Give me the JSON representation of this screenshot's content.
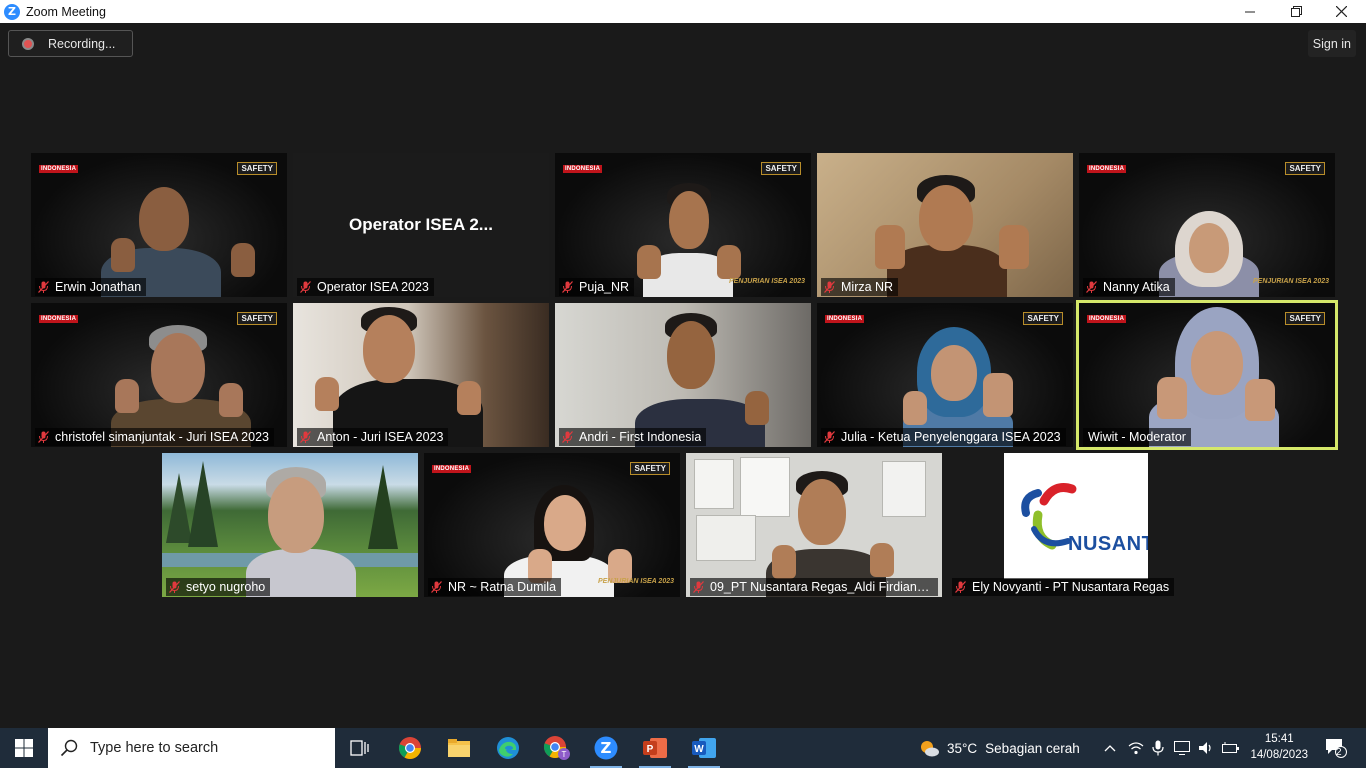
{
  "window": {
    "title": "Zoom Meeting",
    "minimize_icon": "minimize-icon",
    "maximize_icon": "restore-icon",
    "close_icon": "close-icon"
  },
  "toolbar": {
    "recording_label": "Recording...",
    "signin_label": "Sign in"
  },
  "participants": [
    {
      "name": "Erwin Jonathan",
      "muted": true
    },
    {
      "name": "Operator ISEA 2023",
      "muted": true,
      "center_label": "Operator ISEA 2..."
    },
    {
      "name": "Puja_NR",
      "muted": true
    },
    {
      "name": "Mirza NR",
      "muted": true
    },
    {
      "name": "Nanny Atika",
      "muted": true
    },
    {
      "name": "christofel simanjuntak - Juri ISEA 2023",
      "muted": true
    },
    {
      "name": "Anton - Juri ISEA 2023",
      "muted": true
    },
    {
      "name": "Andri - First Indonesia",
      "muted": true
    },
    {
      "name": "Julia - Ketua Penyelenggara ISEA 2023",
      "muted": true
    },
    {
      "name": "Wiwit - Moderator",
      "muted": false,
      "active_speaker": true
    },
    {
      "name": "setyo nugroho",
      "muted": true
    },
    {
      "name": "NR ~ Ratna Dumila",
      "muted": true
    },
    {
      "name": "09_PT Nusantara Regas_Aldi Firdiansy...",
      "muted": true
    },
    {
      "name": "Ely Novyanti - PT Nusantara Regas",
      "muted": true,
      "logo_text": "NUSANT"
    }
  ],
  "virtual_bg": {
    "badge_left": "INDONESIA",
    "badge_right": "SAFETY",
    "penjurian": "PENJURIAN ISEA 2023"
  },
  "taskbar": {
    "search_placeholder": "Type here to search",
    "weather_temp": "35°C",
    "weather_desc": "Sebagian cerah",
    "time": "15:41",
    "date": "14/08/2023",
    "notification_count": "2",
    "apps": [
      "task-view-icon",
      "chrome-icon",
      "file-explorer-icon",
      "edge-icon",
      "chrome-profile-icon",
      "zoom-icon",
      "powerpoint-icon",
      "word-icon"
    ]
  },
  "colors": {
    "active_speaker_border": "#d5e86a",
    "zoom_blue": "#2d8cff",
    "muted_red": "#e0393e",
    "taskbar_bg": "#1f2c3a"
  }
}
